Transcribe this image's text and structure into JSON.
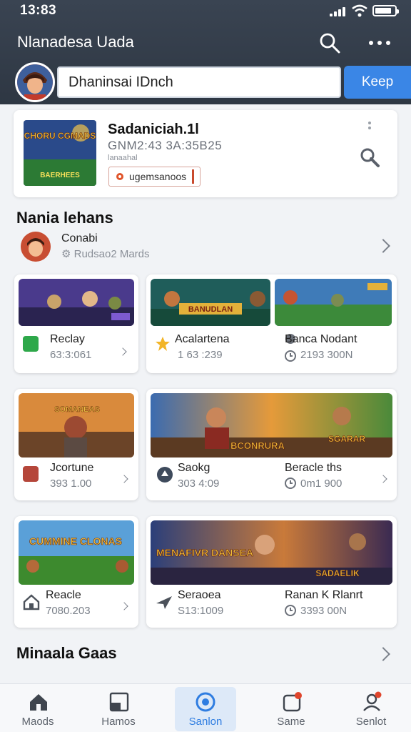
{
  "status": {
    "time": "13:83"
  },
  "header": {
    "title": "Nlanadesa Uada",
    "search_value": "Dhaninsai IDnch",
    "keep_label": "Keep"
  },
  "featured": {
    "title": "Sadaniciah.1l",
    "subtitle": "GNM2:43 3A:35B25",
    "small": "lanaahal",
    "tag": "ugemsanoos",
    "image_text": {
      "top": "CHORU CGMADS",
      "bottom": "BAERHEES"
    }
  },
  "section1": {
    "title": "Nania lehans",
    "profile": {
      "name": "Conabi",
      "meta": "Rudsao2 Mards"
    }
  },
  "cards": [
    {
      "title": "Reclay",
      "sub": "63:3:061",
      "thumb_text": ""
    },
    {
      "title": "Acalartena",
      "sub": "1 63 :239",
      "thumb_text": "BANUDLAN"
    },
    {
      "title": "Banca Nodant",
      "sub": "2193 300N",
      "thumb_text": ""
    },
    {
      "title": "Jcortune",
      "sub": "393 1.00",
      "thumb_text": "SOMANEAS"
    },
    {
      "title": "Saokg",
      "sub": "303 4:09",
      "thumb_text": "BCONRURA"
    },
    {
      "title": "Beracle ths",
      "sub": "0m1 900",
      "thumb_text": "SGARAR"
    },
    {
      "title": "Reacle",
      "sub": "7080.203",
      "thumb_text": "CUMMINE CLONAS"
    },
    {
      "title": "Seraoea",
      "sub": "S13:1009",
      "thumb_text": "MENAFIVR DANSEA"
    },
    {
      "title": "Ranan K Rlanrt",
      "sub": "3393 00N",
      "thumb_text": "SADAELIK"
    }
  ],
  "section2": {
    "title": "Minaala Gaas"
  },
  "nav": [
    {
      "label": "Maods"
    },
    {
      "label": "Hamos"
    },
    {
      "label": "Sanlon"
    },
    {
      "label": "Same"
    },
    {
      "label": "Senlot"
    }
  ],
  "colors": {
    "header_bg": "#323c49",
    "accent": "#3a86e6",
    "page_bg": "#f1f3f6"
  }
}
